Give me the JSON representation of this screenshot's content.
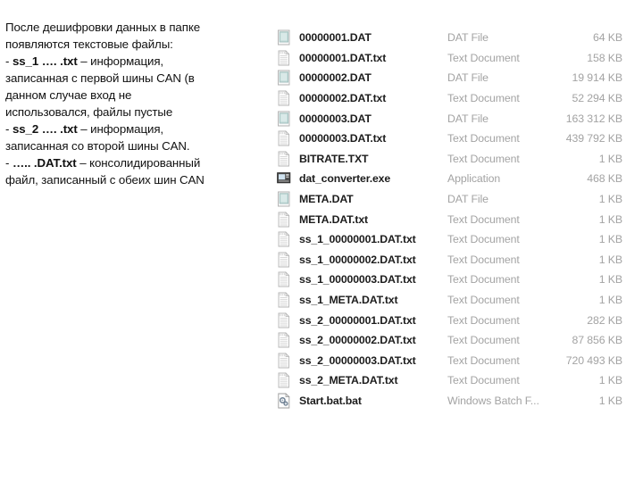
{
  "explanation": {
    "lines": [
      {
        "segments": [
          {
            "text": "После дешифровки данных в папке",
            "bold": false
          }
        ]
      },
      {
        "segments": [
          {
            "text": "появляются текстовые файлы:",
            "bold": false
          }
        ]
      },
      {
        "segments": [
          {
            "text": "- ",
            "bold": false
          },
          {
            "text": "ss_1 …. .txt",
            "bold": true
          },
          {
            "text": " – информация,",
            "bold": false
          }
        ]
      },
      {
        "segments": [
          {
            "text": "записанная с первой шины CAN (в",
            "bold": false
          }
        ]
      },
      {
        "segments": [
          {
            "text": "данном случае вход не",
            "bold": false
          }
        ]
      },
      {
        "segments": [
          {
            "text": "использовался, файлы пустые",
            "bold": false
          }
        ]
      },
      {
        "segments": [
          {
            "text": "- ",
            "bold": false
          },
          {
            "text": "ss_2 …. .txt",
            "bold": true
          },
          {
            "text": " – информация,",
            "bold": false
          }
        ]
      },
      {
        "segments": [
          {
            "text": "записанная со второй шины CAN.",
            "bold": false
          }
        ]
      },
      {
        "segments": [
          {
            "text": "- ",
            "bold": false
          },
          {
            "text": "….. .DAT.txt",
            "bold": true
          },
          {
            "text": " – консолидированный",
            "bold": false
          }
        ]
      },
      {
        "segments": [
          {
            "text": "файл, записанный с обеих шин CAN",
            "bold": false
          }
        ]
      }
    ]
  },
  "file_list": {
    "rows": [
      {
        "icon": "dat-file-icon",
        "name": "00000001.DAT",
        "type": "DAT File",
        "size": "64 KB"
      },
      {
        "icon": "text-document-icon",
        "name": "00000001.DAT.txt",
        "type": "Text Document",
        "size": "158 KB"
      },
      {
        "icon": "dat-file-icon",
        "name": "00000002.DAT",
        "type": "DAT File",
        "size": "19 914 KB"
      },
      {
        "icon": "text-document-icon",
        "name": "00000002.DAT.txt",
        "type": "Text Document",
        "size": "52 294 KB"
      },
      {
        "icon": "dat-file-icon",
        "name": "00000003.DAT",
        "type": "DAT File",
        "size": "163 312 KB"
      },
      {
        "icon": "text-document-icon",
        "name": "00000003.DAT.txt",
        "type": "Text Document",
        "size": "439 792 KB"
      },
      {
        "icon": "text-document-icon",
        "name": "BITRATE.TXT",
        "type": "Text Document",
        "size": "1 KB"
      },
      {
        "icon": "application-exe-icon",
        "name": "dat_converter.exe",
        "type": "Application",
        "size": "468 KB"
      },
      {
        "icon": "dat-file-icon",
        "name": "META.DAT",
        "type": "DAT File",
        "size": "1 KB"
      },
      {
        "icon": "text-document-icon",
        "name": "META.DAT.txt",
        "type": "Text Document",
        "size": "1 KB"
      },
      {
        "icon": "text-document-icon",
        "name": "ss_1_00000001.DAT.txt",
        "type": "Text Document",
        "size": "1 KB"
      },
      {
        "icon": "text-document-icon",
        "name": "ss_1_00000002.DAT.txt",
        "type": "Text Document",
        "size": "1 KB"
      },
      {
        "icon": "text-document-icon",
        "name": "ss_1_00000003.DAT.txt",
        "type": "Text Document",
        "size": "1 KB"
      },
      {
        "icon": "text-document-icon",
        "name": "ss_1_META.DAT.txt",
        "type": "Text Document",
        "size": "1 KB"
      },
      {
        "icon": "text-document-icon",
        "name": "ss_2_00000001.DAT.txt",
        "type": "Text Document",
        "size": "282 KB"
      },
      {
        "icon": "text-document-icon",
        "name": "ss_2_00000002.DAT.txt",
        "type": "Text Document",
        "size": "87 856 KB"
      },
      {
        "icon": "text-document-icon",
        "name": "ss_2_00000003.DAT.txt",
        "type": "Text Document",
        "size": "720 493 KB"
      },
      {
        "icon": "text-document-icon",
        "name": "ss_2_META.DAT.txt",
        "type": "Text Document",
        "size": "1 KB"
      },
      {
        "icon": "batch-file-icon",
        "name": "Start.bat.bat",
        "type": "Windows Batch F...",
        "size": "1 KB"
      }
    ]
  },
  "colors": {
    "background": "#ffffff",
    "file_name_text": "#1c1c1c",
    "secondary_text": "#a3a3a3",
    "body_text": "#111111",
    "dat_icon_tint": "#b9d4d2",
    "exe_icon_dark": "#3c3c3c"
  }
}
